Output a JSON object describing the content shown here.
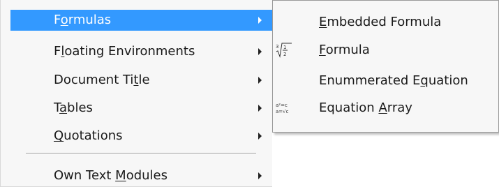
{
  "main_menu": {
    "items": [
      {
        "pre": "F",
        "key": "o",
        "post": "rmulas",
        "active": true
      },
      {
        "pre": "F",
        "key": "l",
        "post": "oating Environments",
        "active": false
      },
      {
        "pre": "Document Ti",
        "key": "t",
        "post": "le",
        "active": false
      },
      {
        "pre": "T",
        "key": "a",
        "post": "bles",
        "active": false
      },
      {
        "pre": "",
        "key": "Q",
        "post": "uotations",
        "active": false
      },
      {
        "pre": "Own Text ",
        "key": "M",
        "post": "odules",
        "active": false
      }
    ]
  },
  "sub_menu": {
    "items": [
      {
        "pre": "",
        "key": "E",
        "post": "mbedded Formula",
        "icon": ""
      },
      {
        "pre": "",
        "key": "F",
        "post": "ormula",
        "icon": "root-fraction-icon"
      },
      {
        "pre": "Enummerated E",
        "key": "q",
        "post": "uation",
        "icon": ""
      },
      {
        "pre": "Equation ",
        "key": "A",
        "post": "rray",
        "icon": "equation-array-icon"
      }
    ]
  },
  "colors": {
    "highlight": "#3399ff",
    "menu_background": "#f7f7f7",
    "text": "#1a1a1a"
  }
}
